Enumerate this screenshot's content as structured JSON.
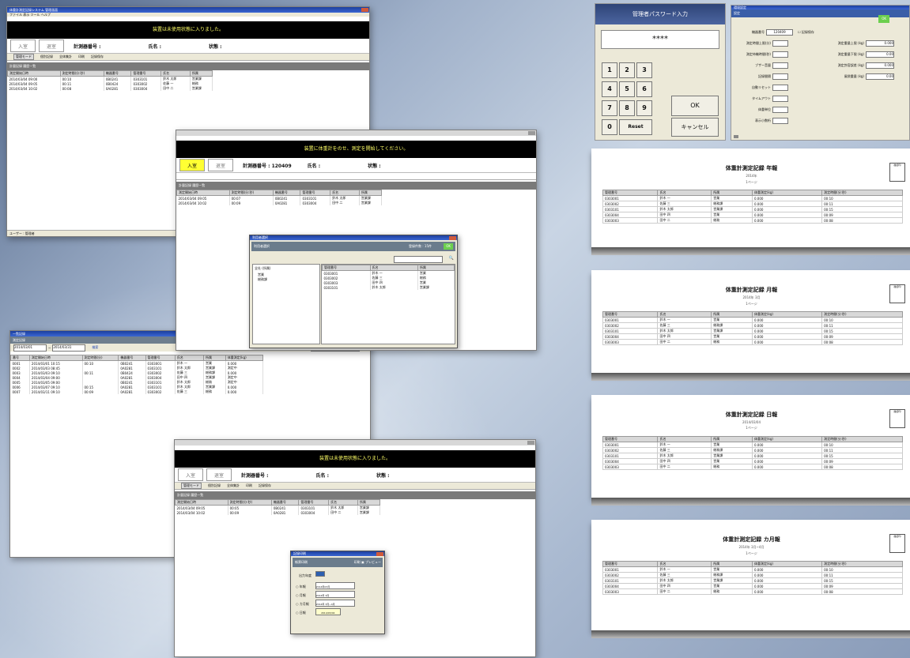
{
  "win1": {
    "title": "体重計測定記録システム 管理画面",
    "menu": "ファイル  表示  ツール  ヘルプ",
    "banner": "装置は未使用状態に入りました。",
    "tab_in": "入室",
    "tab_out": "退室",
    "field_device": "計測器番号 :",
    "field_name": "氏名 :",
    "field_status": "状態 :",
    "toolbar_items": [
      "管理モード",
      "個別記録",
      "全体集計",
      "印刷",
      "記録保存"
    ],
    "section": "計量記録 履歴一覧",
    "columns": [
      "測定開始日時",
      "測定時間(分:秒)",
      "機器番号",
      "管理番号",
      "氏名",
      "所属"
    ],
    "rows": [
      [
        "2014/03/04 09:00",
        "00:10",
        "0B0241",
        "0303101",
        "鈴木 太郎",
        "営業課"
      ],
      [
        "2014/03/04 09:05",
        "00:11",
        "0B0424",
        "0303002",
        "佐藤 一",
        "総務"
      ],
      [
        "2014/03/04 10:02",
        "00:08",
        "0A0281",
        "0303004",
        "田中 二",
        "営業課"
      ]
    ],
    "status": "ユーザー : 管理者"
  },
  "win2": {
    "banner": "装置に体重計をのせ、測定を開始してください。",
    "tab_in": "入室",
    "tab_out": "退室",
    "field_device": "計測器番号 : 120409",
    "field_name": "氏名 :",
    "field_status": "状態 :",
    "section": "計量記録 履歴一覧",
    "columns": [
      "測定開始日時",
      "測定時間(分:秒)",
      "機器番号",
      "管理番号",
      "氏名",
      "所属"
    ],
    "rows": [
      [
        "2014/03/04 09:05",
        "00:07",
        "0B0241",
        "0303101",
        "鈴木 太郎",
        "営業課"
      ],
      [
        "2014/03/04 10:02",
        "00:09",
        "0A0281",
        "0303004",
        "田中 二",
        "営業課"
      ]
    ],
    "dialog": {
      "title": "利用者選択",
      "panel": "利用者選択",
      "panel_right": "登録件数 : 15件",
      "ok": "OK",
      "tree": [
        "全社 (所属)",
        "営業",
        "総務課"
      ],
      "list_cols": [
        "管理番号",
        "氏名",
        "所属"
      ],
      "list_rows": [
        [
          "0303001",
          "鈴木 一",
          "営業"
        ],
        [
          "0303002",
          "佐藤 三",
          "総務"
        ],
        [
          "0303003",
          "田中 四",
          "営業"
        ],
        [
          "0303101",
          "鈴木 太郎",
          "営業課"
        ]
      ]
    }
  },
  "win3": {
    "title": "一覧記録",
    "header": "測定記録",
    "header_right": "記録検索 : 全て",
    "date_from": "2014/03/01",
    "date_to": "2014/03/31",
    "search": "検索",
    "columns": [
      "番号",
      "測定開始日時",
      "測定時間(分)",
      "機器番号",
      "管理番号",
      "氏名",
      "所属",
      "体重測定(kg)"
    ],
    "rows": [
      [
        "0001",
        "2014/03/01 10:15",
        "00:10",
        "0B0241",
        "0303001",
        "鈴木 一",
        "営業",
        "0.000"
      ],
      [
        "0002",
        "2014/03/03 08:45",
        "",
        "0A0281",
        "0303101",
        "鈴木 太郎",
        "営業課",
        "測定中"
      ],
      [
        "0003",
        "2014/03/03 09:10",
        "00:11",
        "0B0424",
        "0303002",
        "佐藤 三",
        "総務課",
        "0.000"
      ],
      [
        "0004",
        "2014/03/04 09:00",
        "",
        "0A0281",
        "0303004",
        "田中 四",
        "営業課",
        "測定中"
      ],
      [
        "0005",
        "2014/03/05 09:00",
        "",
        "0B0241",
        "0303101",
        "鈴木 太郎",
        "総務",
        "測定中"
      ],
      [
        "0006",
        "2014/03/07 09:10",
        "00:15",
        "0A0281",
        "0303101",
        "鈴木 太郎",
        "営業課",
        "0.000"
      ],
      [
        "0007",
        "2014/03/11 09:10",
        "00:09",
        "0A0281",
        "0303002",
        "佐藤 三",
        "総務",
        "0.000"
      ]
    ]
  },
  "win4": {
    "banner": "装置は未使用状態に入りました。",
    "tab_in": "入室",
    "tab_out": "退室",
    "field_device": "計測器番号 :",
    "field_name": "氏名 :",
    "field_status": "状態 :",
    "toolbar_items": [
      "管理モード",
      "個別記録",
      "全体集計",
      "印刷",
      "記録保存"
    ],
    "section": "計量記録 履歴一覧",
    "columns": [
      "測定開始日時",
      "測定時間(分:秒)",
      "機器番号",
      "管理番号",
      "氏名",
      "所属"
    ],
    "rows": [
      [
        "2014/03/04 09:05",
        "00:05",
        "0B0241",
        "0303101",
        "鈴木 太郎",
        "営業課"
      ],
      [
        "2014/03/04 10:02",
        "00:09",
        "0A0281",
        "0303004",
        "田中 二",
        "営業課"
      ]
    ],
    "dialog": {
      "title": "記録印刷",
      "panel": "帳票印刷",
      "panel_right": "印刷 ▣ プレビュー",
      "label_year": "出力年度",
      "options": [
        "年報",
        "月報",
        "カ月報",
        "日報"
      ],
      "values": [
        "2014年03月",
        "2014年 3月",
        "2014年 3月~4月",
        "2014/03/04"
      ]
    }
  },
  "keypad": {
    "title": "管理者パスワード入力",
    "display": "****",
    "keys": [
      "1",
      "2",
      "3",
      "4",
      "5",
      "6",
      "7",
      "8",
      "9",
      "0",
      "Reset"
    ],
    "ok": "OK",
    "cancel": "キャンセル"
  },
  "settings": {
    "title": "環境設定",
    "tab": "設定",
    "ok": "OK",
    "device_label": "機器番号",
    "device_value": "120409",
    "checkbox": "記録保存",
    "left_rows": [
      "測定時間上限(分)",
      "測定待機時間(秒)",
      "ブザー音量",
      "記録間隔",
      "自動リセット",
      "タイムアウト",
      "体重単位",
      "表示小数桁"
    ],
    "right_rows": [
      "測定重量上限 (kg)",
      "測定重量下限 (kg)",
      "測定許容誤差 (kg)",
      "風袋重量 (kg)"
    ],
    "right_values": [
      "0.000",
      "0.00",
      "0.000",
      "0.00"
    ]
  },
  "reports": [
    {
      "title": "体重計測定記録 年報",
      "subtitle": "2014年",
      "sub2": "1ページ",
      "stamp": "確認印"
    },
    {
      "title": "体重計測定記録 月報",
      "subtitle": "2014年 3月",
      "sub2": "1ページ",
      "stamp": "確認印"
    },
    {
      "title": "体重計測定記録 日報",
      "subtitle": "2014/03/04",
      "sub2": "1ページ",
      "stamp": "確認印"
    },
    {
      "title": "体重計測定記録 カ月報",
      "subtitle": "2014年 3月~4月",
      "sub2": "1ページ",
      "stamp": "確認印"
    }
  ],
  "report_columns": [
    "管理番号",
    "氏名",
    "所属",
    "体重測定(kg)",
    "測定時間(分:秒)"
  ],
  "report_rows": [
    [
      "0303001",
      "鈴木 一",
      "営業",
      "0.000",
      "00:10"
    ],
    [
      "0303002",
      "佐藤 三",
      "総務課",
      "0.000",
      "00:11"
    ],
    [
      "0303101",
      "鈴木 太郎",
      "営業課",
      "0.000",
      "00:15"
    ],
    [
      "0303004",
      "田中 四",
      "営業",
      "0.000",
      "00:09"
    ],
    [
      "0303003",
      "田中 二",
      "総務",
      "0.000",
      "00:08"
    ]
  ]
}
